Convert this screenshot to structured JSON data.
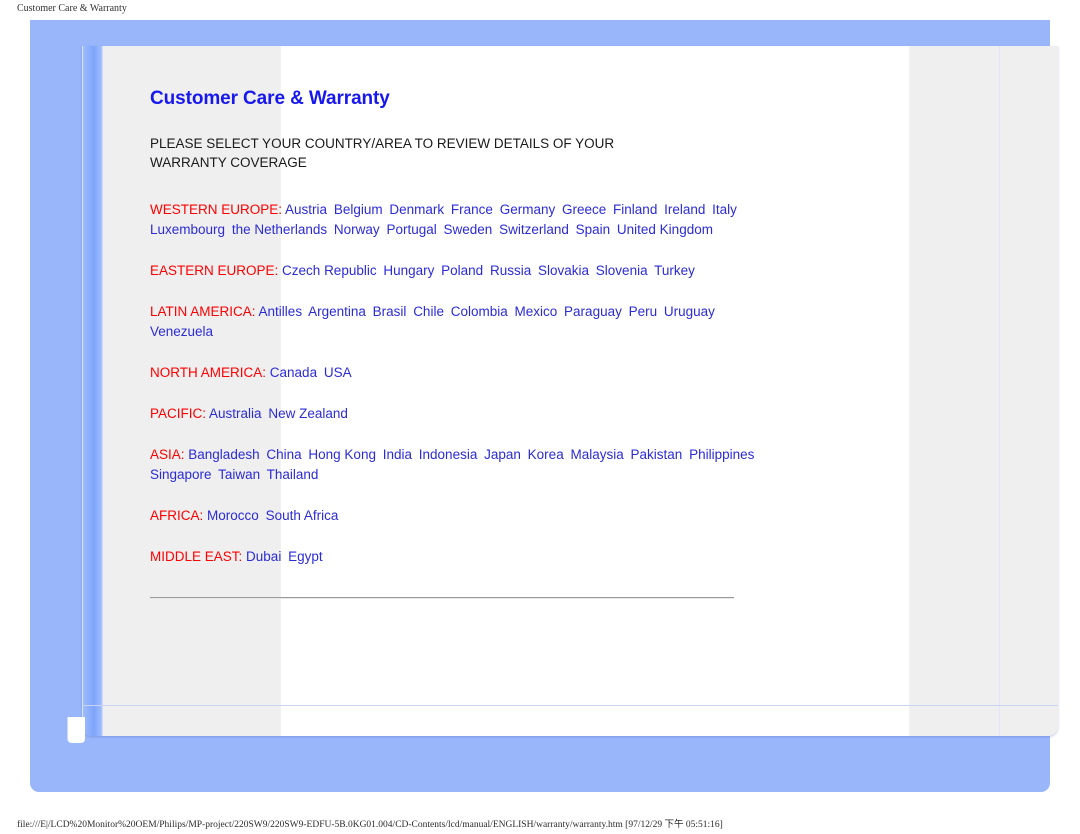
{
  "print_header": {
    "title": "Customer Care & Warranty"
  },
  "colors": {
    "title_blue": "#1717EF",
    "link_blue": "#2B2BD8",
    "region_red": "#FF0000",
    "panel_blue": "#99B6FB",
    "card_gray": "#EFEFEF"
  },
  "page": {
    "title": "Customer Care & Warranty",
    "intro": "PLEASE SELECT YOUR COUNTRY/AREA TO REVIEW DETAILS OF YOUR WARRANTY COVERAGE"
  },
  "regions": [
    {
      "label": "WESTERN EUROPE:",
      "countries": [
        "Austria",
        "Belgium",
        "Denmark",
        "France",
        "Germany",
        "Greece",
        "Finland",
        "Ireland",
        "Italy",
        "Luxembourg",
        "the Netherlands",
        "Norway",
        "Portugal",
        "Sweden",
        "Switzerland",
        "Spain",
        "United Kingdom"
      ]
    },
    {
      "label": "EASTERN EUROPE:",
      "countries": [
        "Czech Republic",
        "Hungary",
        "Poland",
        "Russia",
        "Slovakia",
        "Slovenia",
        "Turkey"
      ]
    },
    {
      "label": "LATIN AMERICA:",
      "countries": [
        "Antilles",
        "Argentina",
        "Brasil",
        "Chile",
        "Colombia",
        "Mexico",
        "Paraguay",
        "Peru",
        "Uruguay",
        "Venezuela"
      ]
    },
    {
      "label": "NORTH AMERICA:",
      "countries": [
        "Canada",
        "USA"
      ]
    },
    {
      "label": "PACIFIC:",
      "countries": [
        "Australia",
        "New Zealand"
      ]
    },
    {
      "label": "ASIA:",
      "countries": [
        "Bangladesh",
        "China",
        "Hong Kong",
        "India",
        "Indonesia",
        "Japan",
        "Korea",
        "Malaysia",
        "Pakistan",
        "Philippines",
        "Singapore",
        "Taiwan",
        "Thailand"
      ]
    },
    {
      "label": "AFRICA:",
      "countries": [
        "Morocco",
        "South Africa"
      ]
    },
    {
      "label": "MIDDLE EAST:",
      "countries": [
        "Dubai",
        "Egypt"
      ]
    }
  ],
  "status_bar": {
    "path": "file:///E|/LCD%20Monitor%20OEM/Philips/MP-project/220SW9/220SW9-EDFU-5B.0KG01.004/CD-Contents/lcd/manual/ENGLISH/warranty/warranty.htm [97/12/29 下午 05:51:16]"
  }
}
